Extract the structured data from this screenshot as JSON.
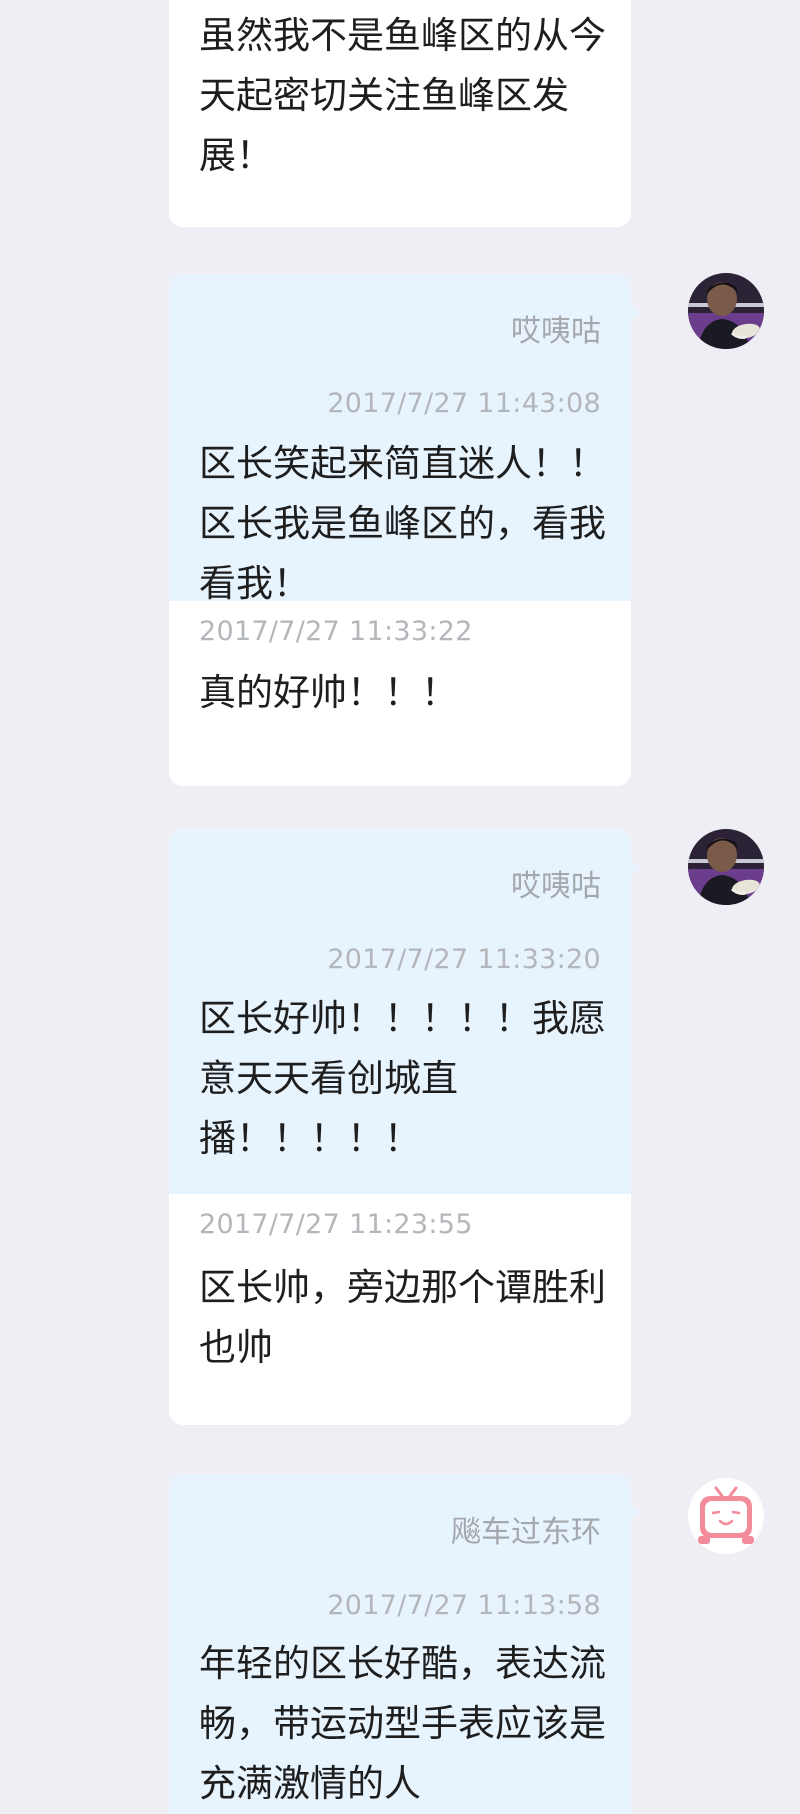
{
  "messages": [
    {
      "reply_text": "虽然我不是鱼峰区的从今天起密切关注鱼峰区发展！"
    },
    {
      "sender": "哎咦咕",
      "time": "2017/7/27 11:43:08",
      "text": "区长笑起来简直迷人！！区长我是鱼峰区的，看我看我！",
      "quoted_time": "2017/7/27 11:33:22",
      "quoted_text": "真的好帅！！！",
      "avatar_icon": "person-photo-avatar-icon"
    },
    {
      "sender": "哎咦咕",
      "time": "2017/7/27 11:33:20",
      "text": "区长好帅！！！！！我愿意天天看创城直播！！！！！",
      "quoted_time": "2017/7/27 11:23:55",
      "quoted_text": "区长帅，旁边那个谭胜利也帅",
      "avatar_icon": "person-photo-avatar-icon"
    },
    {
      "sender": "飚车过东环",
      "time": "2017/7/27 11:13:58",
      "text": "年轻的区长好酷，表达流畅，带运动型手表应该是充满激情的人",
      "avatar_icon": "tv-mascot-avatar-icon"
    }
  ],
  "colors": {
    "page_background": "#efeef4",
    "bubble_top": "#e8f4fd",
    "bubble_bottom": "#ffffff",
    "sender_text": "#a4a8ad",
    "time_text": "#b3b6ba",
    "message_text": "#1e1e1e",
    "mascot_pink": "#f28b9a"
  }
}
